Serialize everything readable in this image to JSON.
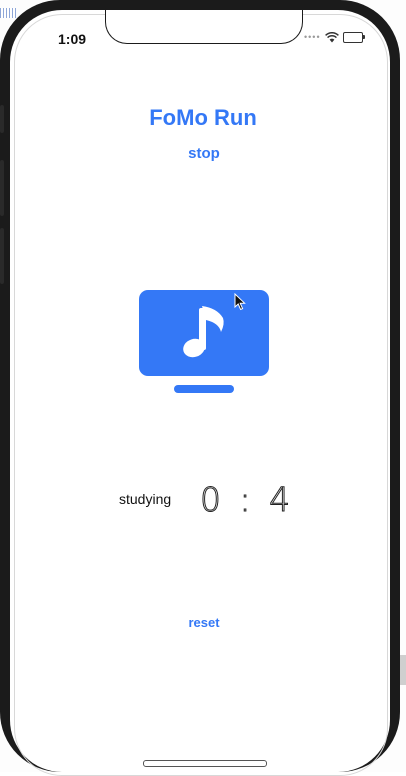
{
  "status_bar": {
    "time": "1:09",
    "icons": [
      "signal-dots-icon",
      "wifi-icon",
      "battery-icon"
    ]
  },
  "app": {
    "title": "FoMo Run",
    "stop_label": "stop",
    "media_icon": "music-tv-icon",
    "activity_label": "studying",
    "timer_text": "0 : 4",
    "reset_label": "reset"
  },
  "colors": {
    "accent": "#3478f6",
    "text": "#111111",
    "frame": "#1b1b1b"
  }
}
